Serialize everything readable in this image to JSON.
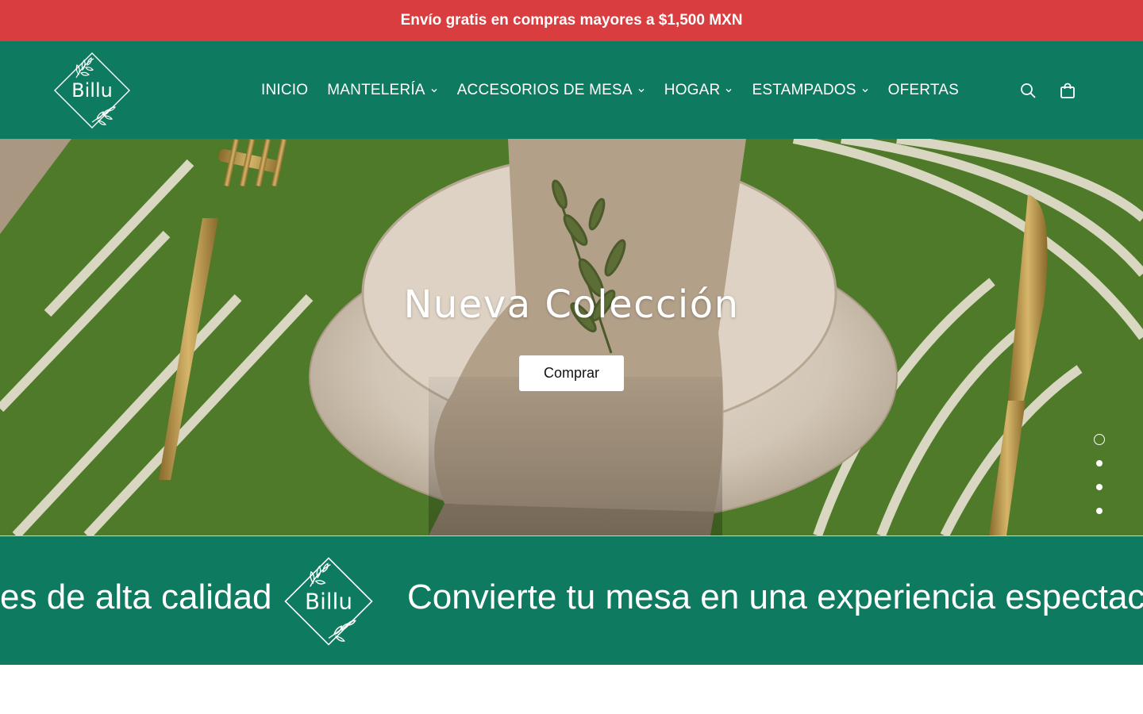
{
  "announcement": {
    "text": "Envío gratis en compras mayores a $1,500 MXN"
  },
  "brand": {
    "logo_text": "Billu"
  },
  "nav": {
    "items": [
      {
        "label": "INICIO",
        "has_dropdown": false
      },
      {
        "label": "MANTELERÍA",
        "has_dropdown": true
      },
      {
        "label": "ACCESORIOS DE MESA",
        "has_dropdown": true
      },
      {
        "label": "HOGAR",
        "has_dropdown": true
      },
      {
        "label": "ESTAMPADOS",
        "has_dropdown": true
      },
      {
        "label": "OFERTAS",
        "has_dropdown": false
      }
    ]
  },
  "header_icons": {
    "search": "search-icon",
    "cart": "shopping-bag-icon"
  },
  "hero": {
    "title": "Nueva Colección",
    "cta_label": "Comprar",
    "slide_count": 4,
    "active_slide": 1
  },
  "marquee": {
    "text_left": "es de alta calidad",
    "text_right": "Convierte tu mesa en una experiencia espectacular"
  },
  "colors": {
    "announcement_bg": "#d93d3f",
    "header_bg": "#0e7a5f",
    "text_on_dark": "#ffffff"
  }
}
